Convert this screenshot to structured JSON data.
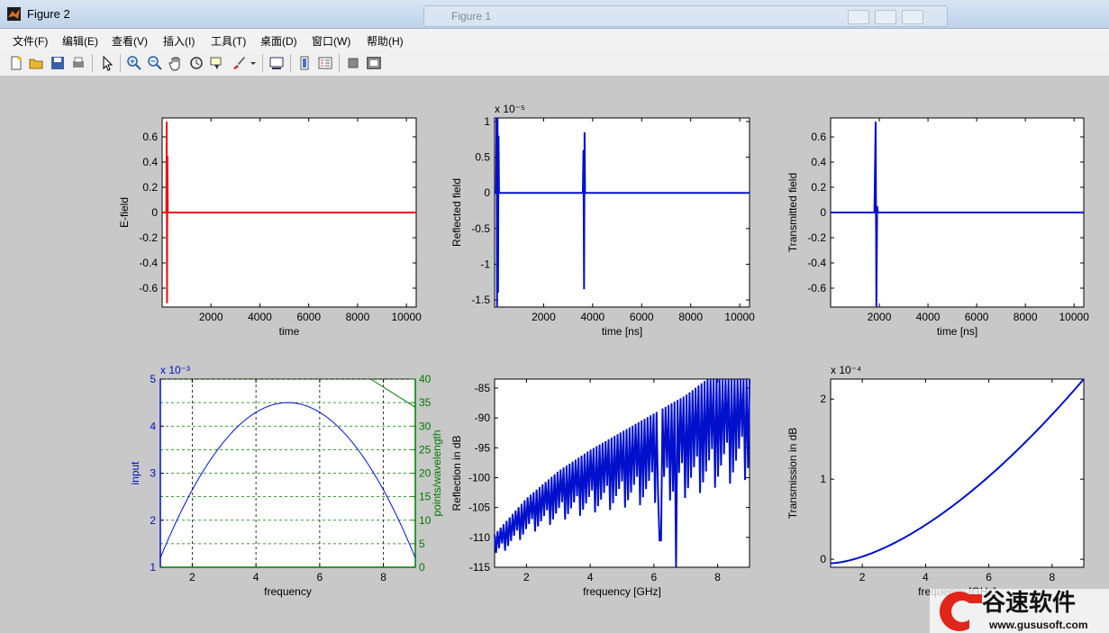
{
  "window": {
    "title": "Figure 2",
    "background_title": "Figure 1"
  },
  "menu": [
    "文件(F)",
    "编辑(E)",
    "查看(V)",
    "插入(I)",
    "工具(T)",
    "桌面(D)",
    "窗口(W)",
    "帮助(H)"
  ],
  "toolbar": [
    "new-file-icon",
    "open-folder-icon",
    "save-icon",
    "print-icon",
    "pointer-icon",
    "zoom-in-icon",
    "zoom-out-icon",
    "pan-hand-icon",
    "rotate-3d-icon",
    "data-cursor-icon",
    "brush-icon",
    "brush-dropdown-icon",
    "link-plot-icon",
    "colorbar-icon",
    "legend-icon",
    "hide-plot-tools-icon",
    "show-plot-tools-icon"
  ],
  "colors": {
    "red": "#ee1111",
    "blue": "#0010cc",
    "green": "#007a00"
  },
  "chart_data": [
    {
      "type": "line",
      "id": "p1",
      "xlabel": "time",
      "ylabel": "E-field",
      "color": "red",
      "xlim": [
        0,
        10400
      ],
      "ylim": [
        -0.75,
        0.75
      ],
      "xticks": [
        2000,
        4000,
        6000,
        8000,
        10000
      ],
      "yticks": [
        -0.6,
        -0.4,
        -0.2,
        0,
        0.2,
        0.4,
        0.6
      ],
      "ytick_labels": [
        "-0.6",
        "-0.4",
        "-0.2",
        "0",
        "0.2",
        "0.4",
        "0.6"
      ],
      "exponent": "",
      "series": [
        {
          "x": [
            0,
            170,
            185,
            200,
            215,
            230,
            10400
          ],
          "y": [
            0,
            0,
            0.72,
            -0.72,
            0.45,
            0,
            0
          ]
        }
      ]
    },
    {
      "type": "line",
      "id": "p2",
      "xlabel": "time [ns]",
      "ylabel": "Reflected field",
      "color": "blue",
      "xlim": [
        0,
        10400
      ],
      "ylim": [
        -1.6,
        1.05
      ],
      "xticks": [
        2000,
        4000,
        6000,
        8000,
        10000
      ],
      "yticks": [
        -1.5,
        -1,
        -0.5,
        0,
        0.5,
        1
      ],
      "ytick_labels": [
        "-1.5",
        "-1",
        "-0.5",
        "0",
        "0.5",
        "1"
      ],
      "exponent": "x 10⁻⁵",
      "series": [
        {
          "x": [
            0,
            60,
            80,
            100,
            120,
            140,
            160,
            180,
            3600,
            3625,
            3650,
            3670,
            3690,
            10400
          ],
          "y": [
            0,
            0,
            1.05,
            -1.6,
            1.05,
            -1.4,
            0.8,
            0,
            0,
            0.6,
            -1.35,
            0.85,
            0,
            0
          ]
        }
      ]
    },
    {
      "type": "line",
      "id": "p3",
      "xlabel": "time [ns]",
      "ylabel": "Transmitted field",
      "color": "blue",
      "xlim": [
        0,
        10400
      ],
      "ylim": [
        -0.75,
        0.75
      ],
      "xticks": [
        2000,
        4000,
        6000,
        8000,
        10000
      ],
      "yticks": [
        -0.6,
        -0.4,
        -0.2,
        0,
        0.2,
        0.4,
        0.6
      ],
      "ytick_labels": [
        "-0.6",
        "-0.4",
        "-0.2",
        "0",
        "0.2",
        "0.4",
        "0.6"
      ],
      "exponent": "",
      "series": [
        {
          "x": [
            0,
            1800,
            1850,
            1880,
            1910,
            1940,
            10400
          ],
          "y": [
            0,
            0,
            0.72,
            -0.75,
            0.05,
            0,
            0
          ]
        }
      ]
    },
    {
      "type": "line",
      "id": "p4",
      "xlabel": "frequency",
      "ylabel": "input",
      "ylabel_right": "points/wavelength",
      "color": "blue",
      "color_right": "green",
      "grid": true,
      "xlim": [
        1,
        9
      ],
      "ylim": [
        1,
        5
      ],
      "ylim_right": [
        0,
        40
      ],
      "xticks": [
        2,
        4,
        6,
        8
      ],
      "yticks": [
        1,
        2,
        3,
        4,
        5
      ],
      "ytick_labels": [
        "1",
        "2",
        "3",
        "4",
        "5"
      ],
      "yticks_right": [
        0,
        5,
        10,
        15,
        20,
        25,
        30,
        35,
        40
      ],
      "exponent": "x 10⁻³",
      "series": [
        {
          "name": "input",
          "x": [
            1,
            1.5,
            2,
            2.5,
            3,
            3.5,
            4,
            4.5,
            5,
            5.5,
            6,
            6.5,
            7,
            7.5,
            8,
            8.5,
            9
          ],
          "y": [
            1.2,
            1.72,
            2.25,
            2.75,
            3.25,
            3.7,
            4.05,
            4.35,
            4.5,
            4.4,
            4.1,
            3.75,
            3.3,
            2.8,
            2.3,
            1.95,
            1.7
          ]
        },
        {
          "name": "points/wavelength",
          "axis": "right",
          "x": [
            7.6,
            9
          ],
          "y": [
            40,
            34
          ]
        }
      ]
    },
    {
      "type": "line",
      "id": "p5",
      "xlabel": "frequency [GHz]",
      "ylabel": "Reflection in dB",
      "color": "blue",
      "xlim": [
        1,
        9
      ],
      "ylim": [
        -115,
        -83.5
      ],
      "xticks": [
        2,
        4,
        6,
        8
      ],
      "yticks": [
        -115,
        -110,
        -105,
        -100,
        -95,
        -90,
        -85
      ],
      "ytick_labels": [
        "-115",
        "-110",
        "-105",
        "-100",
        "-95",
        "-90",
        "-85"
      ],
      "exponent": "",
      "series": [
        {
          "x": [
            1,
            2,
            3,
            4,
            5,
            6,
            7,
            8,
            9
          ],
          "y": [
            -110.5,
            -105,
            -101,
            -98,
            -95.5,
            -93,
            -90.5,
            -87,
            -84
          ]
        }
      ]
    },
    {
      "type": "line",
      "id": "p6",
      "xlabel": "frequency [GHz]",
      "ylabel": "Transmission in dB",
      "color": "blue",
      "xlim": [
        1,
        9
      ],
      "ylim": [
        -0.1,
        2.25
      ],
      "xticks": [
        2,
        4,
        6,
        8
      ],
      "yticks": [
        0,
        1,
        2
      ],
      "ytick_labels": [
        "0",
        "1",
        "2"
      ],
      "exponent": "x 10⁻⁴",
      "series": [
        {
          "x": [
            1,
            2,
            3,
            4,
            5,
            6,
            7,
            8,
            9
          ],
          "y": [
            -0.05,
            0.05,
            0.2,
            0.4,
            0.65,
            0.95,
            1.3,
            1.75,
            2.25
          ]
        }
      ]
    }
  ],
  "watermark": {
    "brand": "谷速软件",
    "url": "www.gususoft.com"
  }
}
